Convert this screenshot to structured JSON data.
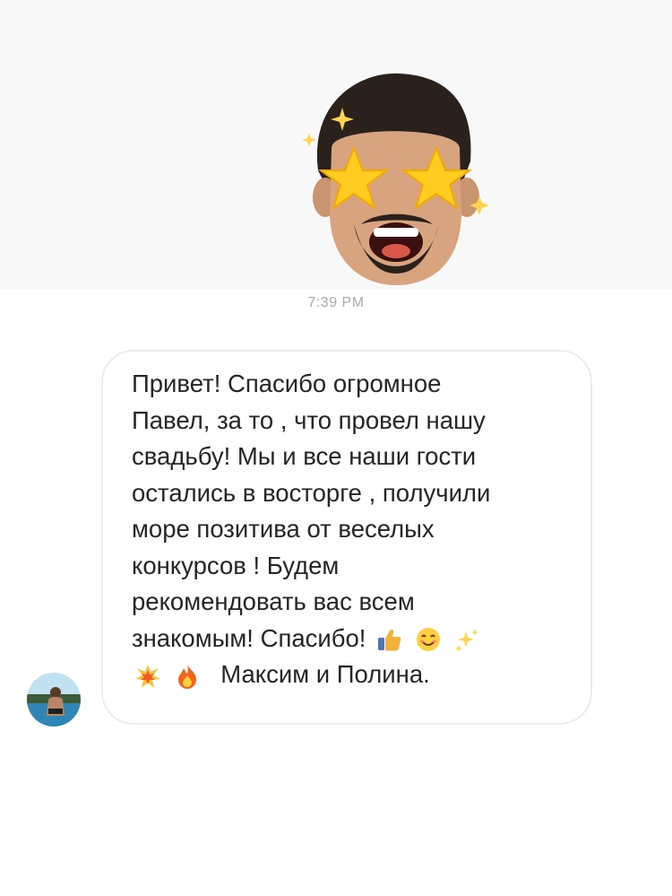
{
  "thread": {
    "timestamp": "7:39 PM"
  },
  "incoming_sticker": {
    "icon": "star-eyes-memoji-icon"
  },
  "message": {
    "sender_avatar_icon": "sender-avatar",
    "lines": [
      "Привет! Спасибо огромное",
      "Павел, за то , что  провел нашу",
      "свадьбу! Мы и все наши гости",
      "остались в восторге , получили",
      "море позитива от веселых",
      "конкурсов ! Будем",
      "рекомендовать вас всем"
    ],
    "line8_text": "знакомым! Спасибо!",
    "line9_text": "Максим и Полина.",
    "emojis": [
      "thumbs-up-icon",
      "smiling-face-icon",
      "sparkles-icon",
      "collision-icon",
      "fire-icon"
    ]
  },
  "colors": {
    "top_panel_bg": "#f8f8f8",
    "timestamp": "#a9a9a9",
    "bubble_border": "#ececec",
    "text": "#262626"
  }
}
